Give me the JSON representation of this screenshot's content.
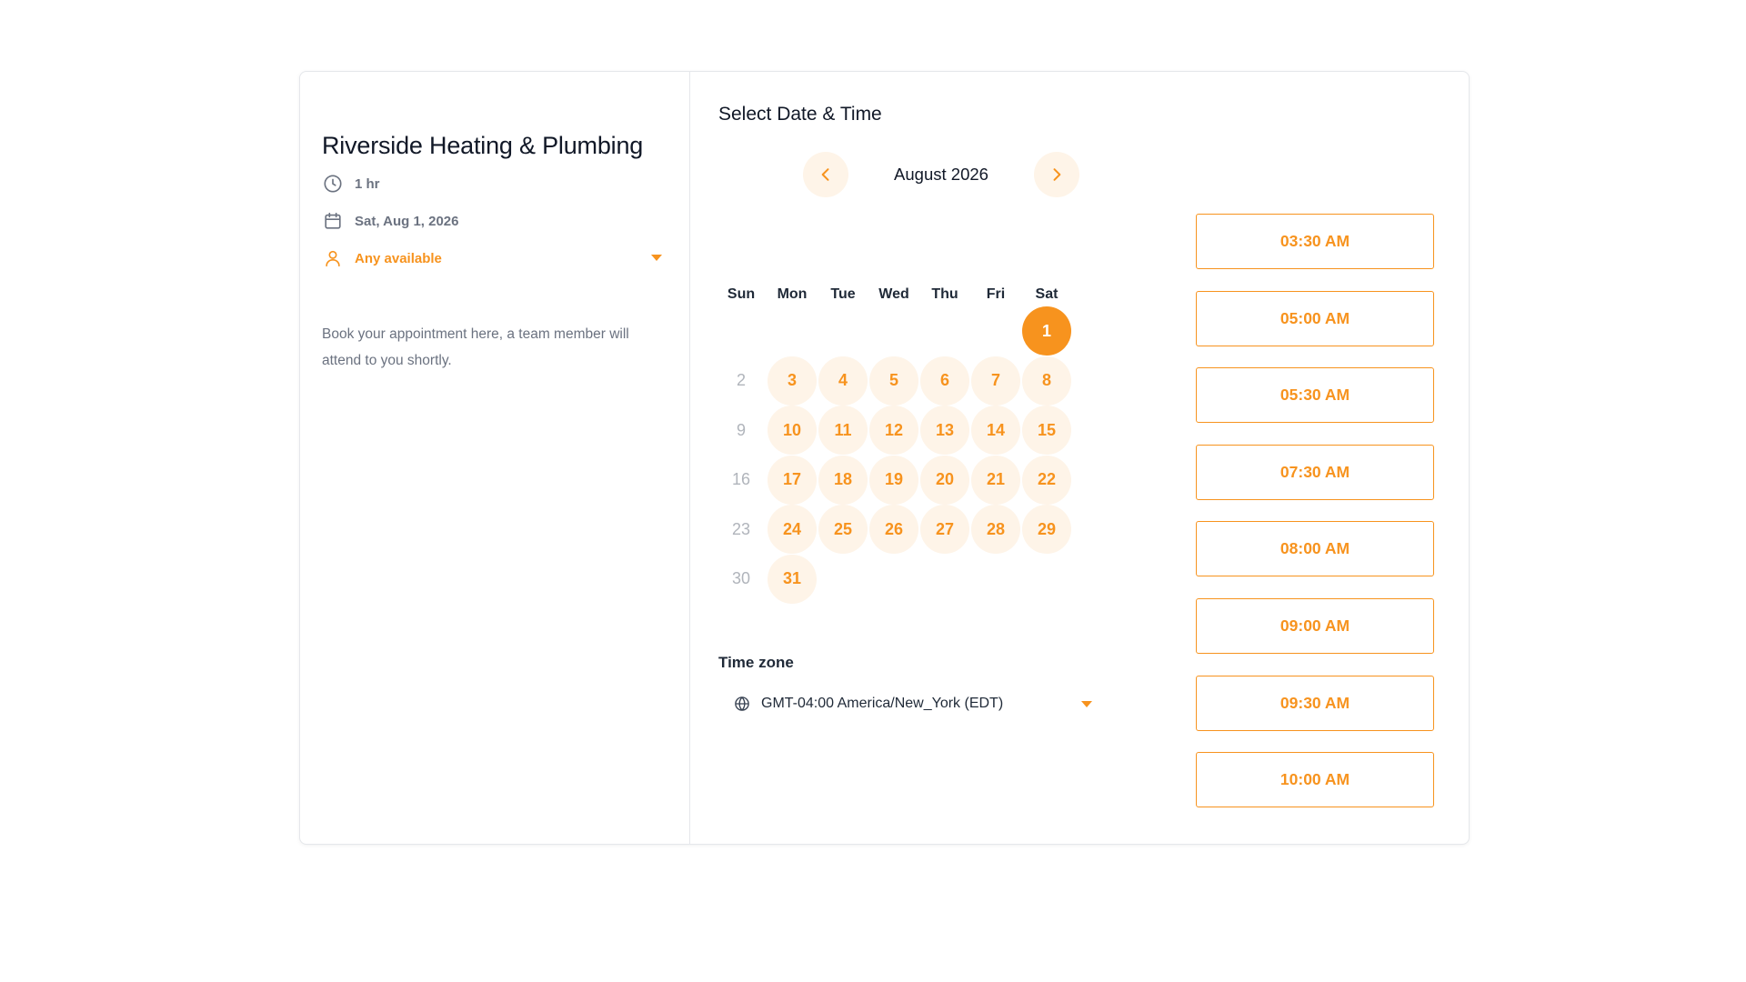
{
  "business": {
    "name": "Riverside Heating & Plumbing",
    "duration": "1 hr",
    "selected_date": "Sat, Aug 1, 2026",
    "staff": "Any available",
    "description": "Book your appointment here, a team member will attend to you shortly."
  },
  "scheduler": {
    "title": "Select Date & Time",
    "month_label": "August 2026",
    "weekdays": [
      "Sun",
      "Mon",
      "Tue",
      "Wed",
      "Thu",
      "Fri",
      "Sat"
    ],
    "first_weekday_index": 6,
    "days_in_month": 31,
    "selected_day": 1,
    "unavailable_days": [
      2,
      9,
      16,
      23,
      30
    ],
    "timezone_label": "Time zone",
    "timezone_value": "GMT-04:00 America/New_York (EDT)"
  },
  "slots": [
    "03:30 AM",
    "05:00 AM",
    "05:30 AM",
    "07:30 AM",
    "08:00 AM",
    "09:00 AM",
    "09:30 AM",
    "10:00 AM"
  ],
  "colors": {
    "accent": "#f7931e",
    "accent_light": "#fef4e8",
    "text_dark": "#111827",
    "text_muted": "#6b7280",
    "disabled": "#b0b4bb"
  },
  "icons": {
    "duration": "clock-icon",
    "date": "calendar-icon",
    "staff": "user-icon",
    "prev": "chevron-left-icon",
    "next": "chevron-right-icon",
    "timezone": "globe-icon"
  }
}
